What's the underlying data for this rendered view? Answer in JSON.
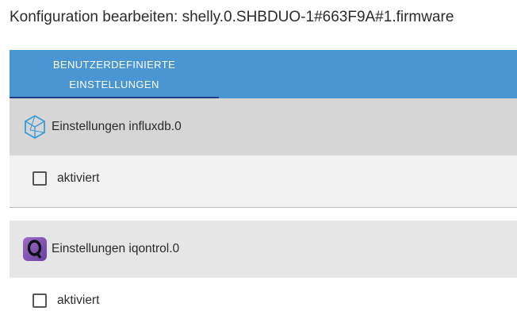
{
  "dialog": {
    "title": "Konfiguration bearbeiten: shelly.0.SHBDUO-1#663F9A#1.firmware"
  },
  "tabs": [
    {
      "label": "BENUTZERDEFINIERTE EINSTELLUNGEN",
      "active": true
    }
  ],
  "sections": [
    {
      "title": "Einstellungen influxdb.0",
      "icon": "influxdb-icon",
      "checkbox_label": "aktiviert",
      "checked": false
    },
    {
      "title": "Einstellungen iqontrol.0",
      "icon": "iqontrol-icon",
      "checkbox_label": "aktiviert",
      "checked": false
    }
  ],
  "colors": {
    "tabbar": "#4a96d3",
    "tab_indicator": "#1f3f86",
    "section_header_1": "#d6d6d6",
    "section_header_2": "#e6e6e6",
    "section_body_1": "#f2f2f2"
  }
}
